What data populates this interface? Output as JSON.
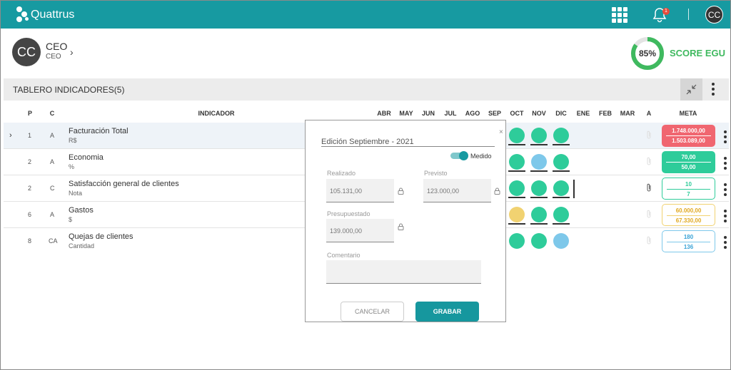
{
  "app": {
    "brand": "Quattrus",
    "notification_count": "1",
    "user_initials": "CC"
  },
  "header": {
    "avatar_initials": "CC",
    "role": "CEO",
    "role_sub": "CEO",
    "score_percent": 85,
    "score_pct_label": "85%",
    "score_label": "SCORE EGU"
  },
  "dashboard": {
    "title": "TABLERO INDICADORES(5)"
  },
  "columns": {
    "p": "P",
    "c": "C",
    "indicador": "INDICADOR",
    "months": [
      "ABR",
      "MAY",
      "JUN",
      "JUL",
      "AGO",
      "SEP",
      "OCT",
      "NOV",
      "DIC",
      "ENE",
      "FEB",
      "MAR"
    ],
    "a": "A",
    "meta": "META"
  },
  "rows": [
    {
      "p": "1",
      "c": "A",
      "name": "Facturación Total",
      "unit": "R$",
      "dots": [
        "green",
        "green",
        "green"
      ],
      "meta_top": "1.748.000,00",
      "meta_bottom": "1.503.089,00",
      "meta_style": "red"
    },
    {
      "p": "2",
      "c": "A",
      "name": "Economia",
      "unit": "%",
      "dots": [
        "green",
        "blue",
        "green"
      ],
      "meta_top": "70,00",
      "meta_bottom": "50,00",
      "meta_style": "green"
    },
    {
      "p": "2",
      "c": "C",
      "name": "Satisfacción general de clientes",
      "unit": "Nota",
      "dots": [
        "green",
        "green",
        "green"
      ],
      "meta_top": "10",
      "meta_bottom": "7",
      "meta_style": "outline-green"
    },
    {
      "p": "6",
      "c": "A",
      "name": "Gastos",
      "unit": "$",
      "dots": [
        "yellow",
        "green",
        "green"
      ],
      "meta_top": "60.000,00",
      "meta_bottom": "67.330,00",
      "meta_style": "outline-yellow"
    },
    {
      "p": "8",
      "c": "CA",
      "name": "Quejas de clientes",
      "unit": "Cantidad",
      "dots": [
        "green",
        "green",
        "blue"
      ],
      "meta_top": "180",
      "meta_bottom": "136",
      "meta_style": "outline-blue"
    }
  ],
  "colors": {
    "brand": "#179aa1",
    "green": "#2ecc9a",
    "blue": "#7ec8ea",
    "yellow": "#f1d271",
    "red": "#f06670",
    "score": "#3fb95f"
  },
  "modal": {
    "close": "×",
    "title": "Edición Septiembre - 2021",
    "toggle_label": "Medido",
    "realizado_label": "Realizado",
    "realizado_value": "105.131,00",
    "previsto_label": "Previsto",
    "previsto_value": "123.000,00",
    "presupuestado_label": "Presupuestado",
    "presupuestado_value": "139.000,00",
    "comentario_label": "Comentario",
    "comentario_value": "",
    "cancel_label": "CANCELAR",
    "save_label": "GRABAR"
  }
}
